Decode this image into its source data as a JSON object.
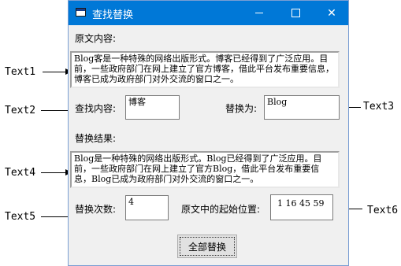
{
  "window": {
    "title": "查找替换",
    "icon": "form-icon",
    "controls": [
      "minimize",
      "maximize",
      "close"
    ]
  },
  "labels": {
    "original": "原文内容:",
    "find": "查找内容:",
    "replace_with": "替换为:",
    "result": "替换结果:",
    "count": "替换次数:",
    "positions": "原文中的起始位置:"
  },
  "fields": {
    "text1": "Blog客是一种特殊的网络出版形式。博客已经得到了广泛应用。目前，一些政府部门在网上建立了官方博客，借此平台发布重要信息，博客已成为政府部门对外交流的窗口之一。",
    "text2": "博客",
    "text3": "Blog",
    "text4": "Blog是一种特殊的网络出版形式。Blog已经得到了广泛应用。目前，一些政府部门在网上建立了官方Blog，借此平台发布重要信息，Blog已成为政府部门对外交流的窗口之一。",
    "text5": "4",
    "text6": "1 16 45 59"
  },
  "button": {
    "replace_all": "全部替换"
  },
  "annotations": {
    "text1": "Text1",
    "text2": "Text2",
    "text3": "Text3",
    "text4": "Text4",
    "text5": "Text5",
    "text6": "Text6"
  },
  "colors": {
    "titlebar": "#0078d7",
    "window_bg": "#f0f0f0"
  }
}
